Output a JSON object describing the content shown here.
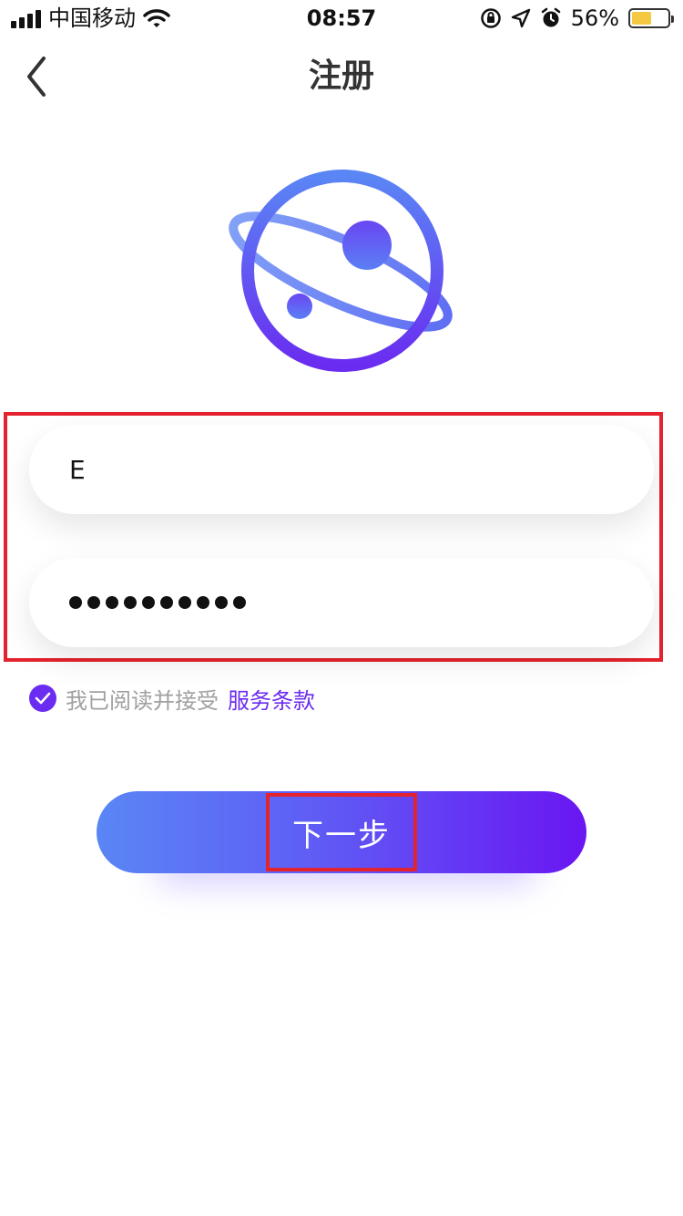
{
  "status_bar": {
    "carrier": "中国移动",
    "time": "08:57",
    "battery_percent_text": "56%",
    "battery_level": 0.56,
    "icons": [
      "signal-icon",
      "wifi-icon",
      "rotation-lock-icon",
      "location-icon",
      "alarm-icon",
      "battery-icon"
    ]
  },
  "nav": {
    "title": "注册",
    "back_icon": "chevron-left-icon"
  },
  "logo": {
    "icon": "planet-icon",
    "colors": {
      "start": "#5a86f5",
      "end": "#6a16f2"
    }
  },
  "form": {
    "email_value": "E",
    "password_masked_length": 10
  },
  "agreement": {
    "checked": true,
    "text": "我已阅读并接受",
    "link_text": "服务条款"
  },
  "next_button": {
    "label": "下一步"
  },
  "colors": {
    "accent": "#6a2cf0",
    "gradient_start": "#5a86f5",
    "gradient_end": "#6a16f2",
    "highlight": "#e3232e"
  }
}
